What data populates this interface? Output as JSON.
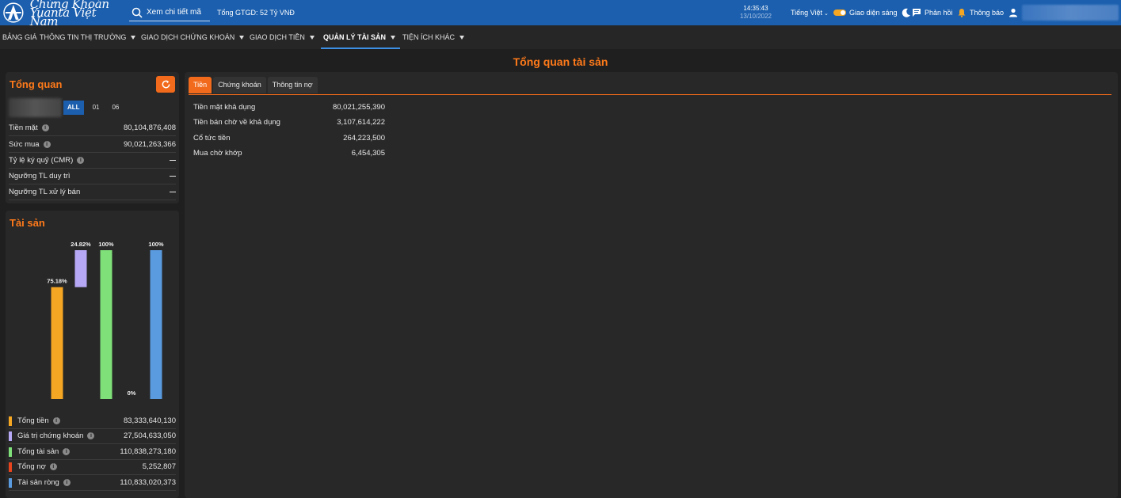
{
  "header": {
    "logo_line1": "Chứng Khoán",
    "logo_line2": "Yuanta Việt Nam",
    "search_placeholder": "Xem chi tiết mã",
    "gtgd": "Tổng GTGD: 52 Tỷ VNĐ",
    "time": "14:35:43",
    "date": "13/10/2022",
    "language": "Tiếng Việt",
    "theme_label": "Giao diện sáng",
    "feedback_label": "Phản hồi",
    "notify_label": "Thông báo",
    "icons": [
      "search-icon",
      "moon-icon",
      "feedback-icon",
      "bell-icon",
      "user-icon"
    ]
  },
  "nav": {
    "items": [
      {
        "label": "BẢNG GIÁ",
        "has_caret": false
      },
      {
        "label": "THÔNG TIN THỊ TRƯỜNG",
        "has_caret": true
      },
      {
        "label": "GIAO DỊCH CHỨNG KHOÁN",
        "has_caret": true
      },
      {
        "label": "GIAO DỊCH TIỀN",
        "has_caret": true
      },
      {
        "label": "QUẢN LÝ TÀI SẢN",
        "has_caret": true,
        "active": true
      },
      {
        "label": "TIỆN ÍCH KHÁC",
        "has_caret": true
      }
    ]
  },
  "page_title": "Tổng quan tài sản",
  "overview": {
    "title": "Tổng quan",
    "account_tabs": [
      "ALL",
      "01",
      "06"
    ],
    "rows": [
      {
        "label": "Tiền mặt",
        "info": true,
        "value": "80,104,876,408"
      },
      {
        "label": "Sức mua",
        "info": true,
        "value": "90,021,263,366"
      },
      {
        "label": "Tỷ lệ ký quỹ (CMR)",
        "info": true,
        "value": null
      },
      {
        "label": "Ngưỡng TL duy trì",
        "info": false,
        "value": null
      },
      {
        "label": "Ngưỡng TL xử lý bán",
        "info": false,
        "value": null
      }
    ]
  },
  "assets": {
    "title": "Tài sản",
    "legend": [
      {
        "label": "Tổng tiền",
        "value": "83,333,640,130",
        "color": "#f5a623"
      },
      {
        "label": "Giá trị chứng khoán",
        "value": "27,504,633,050",
        "color": "#b7a8f5"
      },
      {
        "label": "Tổng tài sản",
        "value": "110,838,273,180",
        "color": "#7fe07a"
      },
      {
        "label": "Tổng nợ",
        "value": "5,252,807",
        "color": "#e8441d"
      },
      {
        "label": "Tài sản ròng",
        "value": "110,833,020,373",
        "color": "#5a9be0"
      }
    ]
  },
  "chart_data": {
    "type": "bar",
    "categories": [
      "Tổng tiền",
      "Giá trị chứng khoán",
      "Tổng tài sản",
      "Tổng nợ",
      "Tài sản ròng"
    ],
    "percent_labels": [
      "75.18%",
      "24.82%",
      "100%",
      "0%",
      "100%"
    ],
    "segments": [
      {
        "from": 0,
        "to": 75.18
      },
      {
        "from": 75.18,
        "to": 100
      },
      {
        "from": 0,
        "to": 100
      },
      {
        "from": 0,
        "to": 0
      },
      {
        "from": 0,
        "to": 100
      }
    ],
    "colors": [
      "#f5a623",
      "#b7a8f5",
      "#7fe07a",
      "#e8441d",
      "#5a9be0"
    ],
    "ylim": [
      0,
      100
    ]
  },
  "main": {
    "tabs": [
      "Tiền",
      "Chứng khoán",
      "Thông tin nợ"
    ],
    "active_tab": 0,
    "cash_rows": [
      {
        "label": "Tiền mặt khả dụng",
        "value": "80,021,255,390"
      },
      {
        "label": "Tiền bán chờ về khả dụng",
        "value": "3,107,614,222"
      },
      {
        "label": "Cổ tức tiền",
        "value": "264,223,500"
      },
      {
        "label": "Mua chờ khớp",
        "value": "6,454,305"
      }
    ]
  }
}
